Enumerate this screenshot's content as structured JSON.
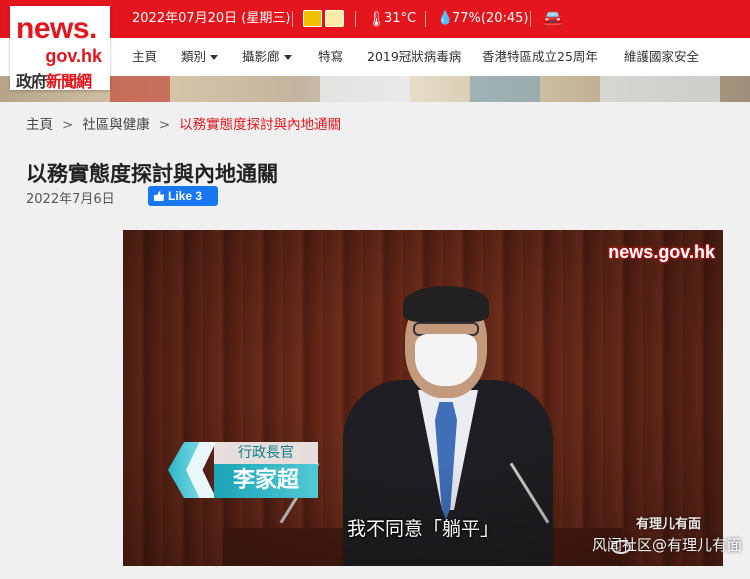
{
  "header": {
    "logo": {
      "line1": "news.",
      "line2": "gov.hk",
      "line3_prefix": "政府",
      "line3_accent": "新聞網"
    },
    "date": "2022年07月20日 (星期三)",
    "temperature": "31°C",
    "humidity": "77%(20:45)",
    "icons": [
      "weather-sunny-icon",
      "weather-warning-icon",
      "thermometer-icon",
      "raindrop-icon",
      "car-icon"
    ],
    "accent_color": "#e4151c"
  },
  "nav": {
    "items": [
      {
        "label": "主頁",
        "dropdown": false
      },
      {
        "label": "類別",
        "dropdown": true
      },
      {
        "label": "攝影廊",
        "dropdown": true
      },
      {
        "label": "特寫",
        "dropdown": false
      },
      {
        "label": "2019冠狀病毒病",
        "dropdown": false
      },
      {
        "label": "香港特區成立25周年",
        "dropdown": false
      },
      {
        "label": "維護國家安全",
        "dropdown": false
      }
    ]
  },
  "breadcrumb": {
    "home": "主頁",
    "section": "社區與健康",
    "current": "以務實態度探討與內地通關",
    "separator": ">"
  },
  "article": {
    "title": "以務實態度探討與內地通關",
    "date": "2022年7月6日",
    "like_label": "Like 3"
  },
  "video": {
    "logo": "news.gov.hk",
    "name_tag_title": "行政長官",
    "name_tag_name": "李家超",
    "subtitle": "我不同意「躺平」"
  },
  "watermark": {
    "line1": "有理儿有面",
    "line2": "风闻社区@有理儿有面"
  }
}
